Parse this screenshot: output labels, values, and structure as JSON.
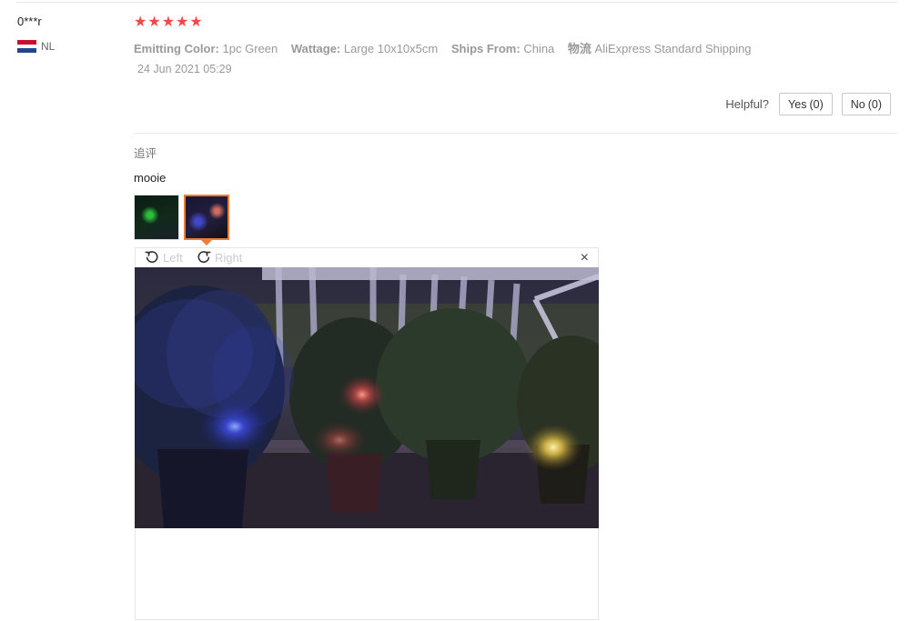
{
  "buyer": {
    "name": "0***r",
    "country": "NL",
    "flag_colors": [
      "#c8102e",
      "#ffffff",
      "#21468b"
    ]
  },
  "review": {
    "rating": 5,
    "stars": [
      "★",
      "★",
      "★",
      "★",
      "★"
    ],
    "star_color": "#f04a48",
    "sku": [
      {
        "key": "Emitting Color:",
        "value": "1pc Green"
      },
      {
        "key": "Wattage:",
        "value": "Large 10x10x5cm"
      },
      {
        "key": "Ships From:",
        "value": "China"
      },
      {
        "key": "物流",
        "value": "AliExpress Standard Shipping"
      }
    ],
    "date": "24 Jun 2021 05:29"
  },
  "helpful": {
    "label": "Helpful?",
    "yes_label": "Yes",
    "yes_count": "(0)",
    "no_label": "No",
    "no_count": "(0)"
  },
  "additional": {
    "title": "追评",
    "text": "mooie",
    "thumbnails": [
      "photo-1",
      "photo-2"
    ],
    "active_thumbnail": 1
  },
  "viewer": {
    "rotate_left_label": "Left",
    "rotate_right_label": "Right",
    "close_symbol": "×",
    "accent_color": "#f07b34"
  }
}
